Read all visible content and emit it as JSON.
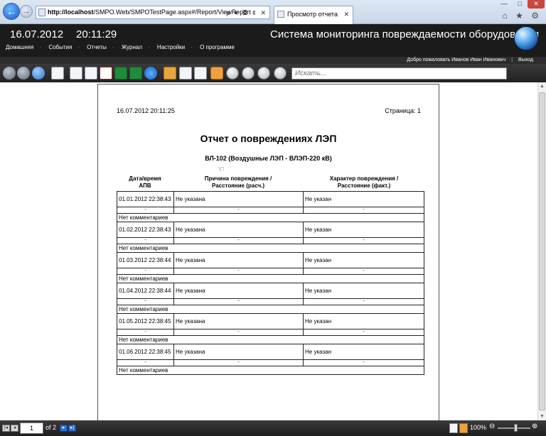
{
  "browser": {
    "address_host": "http://localhost",
    "address_path": "/SMPO.Web/SMPOTestPage.aspx#/Report/ViewReport",
    "address_tools": "ρ ▾ ≣ ¢ ✕",
    "tab_title": "Просмотр отчета",
    "tab_close": "✕",
    "back": "←",
    "forward": "→",
    "win_min": "—",
    "win_max": "□",
    "win_close": "✕",
    "tool_icons": "⌂ ★ ⚙"
  },
  "header": {
    "date": "16.07.2012",
    "time": "20:11:29",
    "title": "Система мониторинга повреждаемости оборудования",
    "nav": [
      "Домашняя",
      "События",
      "Отчеты",
      "Журнал",
      "Настройки",
      "О программе"
    ],
    "nav_sep": "·",
    "welcome": "Добро пожаловать Иванов Иван Иванович",
    "welcome_sep": "|",
    "logout": "Выход"
  },
  "toolbar": {
    "search_placeholder": "Искать...",
    "icons": [
      "back-icon",
      "forward-icon",
      "refresh-icon",
      "print-icon",
      "export-doc-icon",
      "export-xps-icon",
      "export-pdf-icon",
      "export-excel-icon",
      "export-excel-alt-icon",
      "export-html-icon",
      "zoom-100-icon",
      "single-page-icon",
      "multi-page-icon",
      "hand-tool-icon",
      "zoom-out-icon",
      "zoom-in-icon",
      "zoom-tool-icon",
      "zoom-fit-icon"
    ]
  },
  "report": {
    "print_date": "16.07.2012 20:11:25",
    "page_label": "Страница: 1",
    "title": "Отчет о повреждениях ЛЭП",
    "subtitle": "ВЛ-102 (Воздушные ЛЭП - ВЛЭП-220 кВ)",
    "col1_line1": "Дата/время",
    "col1_line2": "АПВ",
    "col2_line1": "Причина повреждения /",
    "col2_line2": "Расстояние (расч.)",
    "col3_line1": "Характер повреждения /",
    "col3_line2": "Расстояние (факт.)",
    "rows": [
      {
        "datetime": "01.01.2012 22:38:43",
        "cause": "Не указана",
        "nature": "Не указан",
        "calc": "-",
        "fact": "-",
        "apv": "-",
        "comment": "Нет комментариев"
      },
      {
        "datetime": "01.02.2012 22:38:43",
        "cause": "Не указана",
        "nature": "Не указан",
        "calc": "-",
        "fact": "-",
        "apv": "-",
        "comment": "Нет комментариев"
      },
      {
        "datetime": "01.03.2012 22:38:44",
        "cause": "Не указана",
        "nature": "Не указан",
        "calc": "-",
        "fact": "-",
        "apv": "-",
        "comment": "Нет комментариев"
      },
      {
        "datetime": "01.04.2012 22:38:44",
        "cause": "Не указана",
        "nature": "Не указан",
        "calc": "-",
        "fact": "-",
        "apv": "-",
        "comment": "Нет комментариев"
      },
      {
        "datetime": "01.05.2012 22:38:45",
        "cause": "Не указана",
        "nature": "Не указан",
        "calc": "-",
        "fact": "-",
        "apv": "-",
        "comment": "Нет комментариев"
      },
      {
        "datetime": "01.06.2012 22:38:45",
        "cause": "Не указана",
        "nature": "Не указан",
        "calc": "-",
        "fact": "-",
        "apv": "-",
        "comment": "Нет комментариев"
      }
    ]
  },
  "status": {
    "first": "|◂",
    "prev": "◂",
    "next": "▸",
    "last": "▸|",
    "page_value": "1",
    "page_of": "of 2",
    "zoom": "100%",
    "zoom_minus": "⊖",
    "zoom_plus": "⊕"
  },
  "scroll": {
    "up": "▲",
    "down": "▼"
  }
}
